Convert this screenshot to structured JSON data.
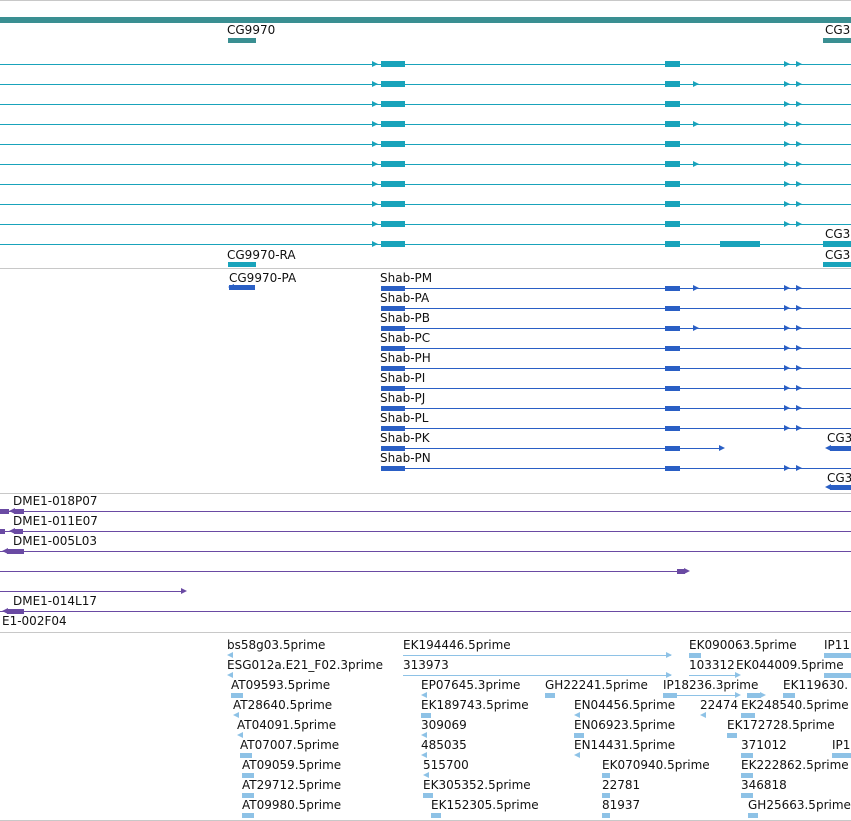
{
  "colors": {
    "gene": "#3a8f92",
    "mrna_ref": "#19a3bb",
    "mrna_flybase": "#2a5fc5",
    "clone": "#6a4aa3",
    "est": "#8ec2e6",
    "separator": "#c8c8c8"
  },
  "tracks": {
    "gene": {
      "labels": [
        "CG9970",
        "CG3"
      ]
    },
    "mrna_ref": {
      "labels": [
        "CG9970-RA",
        "CG3",
        "CG3"
      ]
    },
    "mrna_flybase": {
      "labels": [
        "CG9970-PA",
        "Shab-PM",
        "Shab-PA",
        "Shab-PB",
        "Shab-PC",
        "Shab-PH",
        "Shab-PI",
        "Shab-PJ",
        "Shab-PL",
        "Shab-PK",
        "Shab-PN",
        "CG3",
        "CG3"
      ]
    },
    "clones": {
      "labels": [
        "DME1-018P07",
        "DME1-011E07",
        "DME1-005L03",
        "DME1-014L17",
        "E1-002F04"
      ]
    },
    "ests": {
      "labels": [
        "bs58g03.5prime",
        "ESG012a.E21_F02.3prime",
        "AT09593.5prime",
        "AT28640.5prime",
        "AT04091.5prime",
        "AT07007.5prime",
        "AT09059.5prime",
        "AT29712.5prime",
        "AT09980.5prime",
        "EK194446.5prime",
        "313973",
        "EP07645.3prime",
        "EK189743.5prime",
        "309069",
        "485035",
        "515700",
        "EK305352.5prime",
        "EK152305.5prime",
        "GH22241.5prime",
        "EN04456.5prime",
        "EN06923.5prime",
        "EN14431.5prime",
        "EK070940.5prime",
        "22781",
        "81937",
        "EK090063.5prime",
        "103312",
        "EK044009.5prime",
        "IP18236.3prime",
        "22474",
        "EK248540.5prime",
        "EK119630.",
        "EK172728.5prime",
        "371012",
        "EK222862.5prime",
        "346818",
        "GH25663.5prime",
        "IP11",
        "IP1"
      ]
    }
  }
}
